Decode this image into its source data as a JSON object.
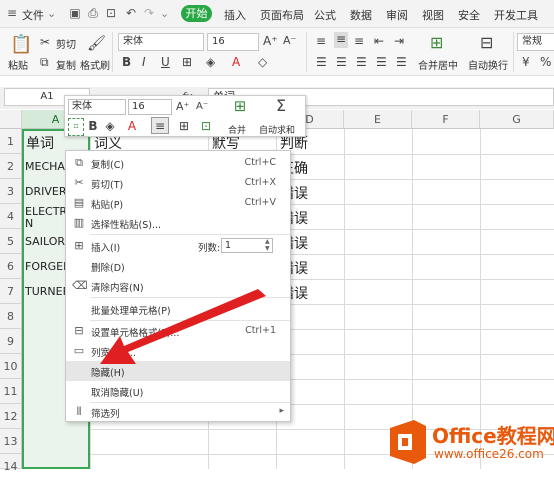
{
  "menubar": {
    "file": "文件",
    "tabs": [
      "开始",
      "插入",
      "页面布局",
      "公式",
      "数据",
      "审阅",
      "视图",
      "安全",
      "开发工具"
    ]
  },
  "ribbon": {
    "paste": "粘贴",
    "cut": "剪切",
    "copy": "复制",
    "format_painter": "格式刷",
    "font_name": "宋体",
    "font_size": "16",
    "merge_center": "合并居中",
    "wrap_text": "自动换行",
    "number_format": "常规"
  },
  "formula_bar": {
    "name_box": "A1",
    "fx": "fx",
    "value": "单词"
  },
  "columns": [
    "A",
    "B",
    "C",
    "D",
    "E",
    "F",
    "G"
  ],
  "rows": [
    "1",
    "2",
    "3",
    "4",
    "5",
    "6",
    "7",
    "8",
    "9",
    "10",
    "11",
    "12",
    "13",
    "14"
  ],
  "cells": {
    "A1": "单词",
    "B1": "词义",
    "C1": "默写",
    "D1": "判断",
    "A2": "MECHAN",
    "A3": "DRIVER",
    "A4a": "ELECTR",
    "A4b": "N",
    "A5": "SAILOR",
    "A6": "FORGER",
    "A7": "TURNER",
    "D2": "正确",
    "D3": "错误",
    "D4": "错误",
    "D5": "错误",
    "D6": "错误",
    "D7": "错误"
  },
  "mini_toolbar": {
    "font_name": "宋体",
    "font_size": "16",
    "bold": "B",
    "merge": "合并",
    "autosum": "自动求和"
  },
  "context_menu": {
    "items": [
      {
        "label": "复制(C)",
        "shortcut": "Ctrl+C"
      },
      {
        "label": "剪切(T)",
        "shortcut": "Ctrl+X"
      },
      {
        "label": "粘贴(P)",
        "shortcut": "Ctrl+V"
      },
      {
        "label": "选择性粘贴(S)...",
        "shortcut": ""
      },
      {
        "label": "插入(I)",
        "shortcut": ""
      },
      {
        "label": "删除(D)",
        "shortcut": ""
      },
      {
        "label": "清除内容(N)",
        "shortcut": ""
      },
      {
        "label": "批量处理单元格(P)",
        "shortcut": ""
      },
      {
        "label": "设置单元格格式(F)...",
        "shortcut": "Ctrl+1"
      },
      {
        "label": "列宽(W)...",
        "shortcut": ""
      },
      {
        "label": "隐藏(H)",
        "shortcut": ""
      },
      {
        "label": "取消隐藏(U)",
        "shortcut": ""
      },
      {
        "label": "筛选列",
        "shortcut": ""
      }
    ],
    "columns_label": "列数:",
    "columns_value": "1"
  },
  "watermark": {
    "brand": "Office教程网",
    "url": "www.office26.com"
  },
  "colors": {
    "accent_green": "#28a745",
    "selection_green": "#3aa757",
    "arrow_red": "#e02020",
    "logo_orange": "#e8590c"
  }
}
